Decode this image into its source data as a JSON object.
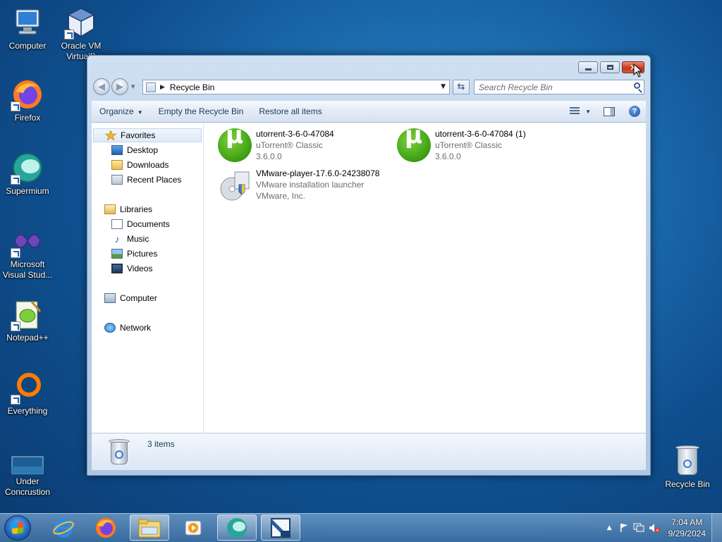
{
  "desktop": {
    "icons": [
      {
        "label": "Computer"
      },
      {
        "label": "Oracle VM VirtualBox",
        "label_line1": "Oracle VM",
        "label_line2": "VirtualB"
      },
      {
        "label": "Firefox"
      },
      {
        "label": "Supermium"
      },
      {
        "label_line1": "Microsoft",
        "label_line2": "Visual Stud..."
      },
      {
        "label": "Notepad++"
      },
      {
        "label": "Everything"
      },
      {
        "label_line1": "Under",
        "label_line2": "Concrustion"
      },
      {
        "label": "Recycle Bin"
      }
    ]
  },
  "window": {
    "address": {
      "crumb": "Recycle Bin"
    },
    "search": {
      "placeholder": "Search Recycle Bin"
    },
    "toolbar": {
      "organize": "Organize",
      "empty": "Empty the Recycle Bin",
      "restore": "Restore all items"
    },
    "nav": {
      "favorites": "Favorites",
      "desktop": "Desktop",
      "downloads": "Downloads",
      "recent": "Recent Places",
      "libraries": "Libraries",
      "documents": "Documents",
      "music": "Music",
      "pictures": "Pictures",
      "videos": "Videos",
      "computer": "Computer",
      "network": "Network"
    },
    "files": [
      {
        "name": "utorrent-3-6-0-47084",
        "desc": "uTorrent® Classic",
        "version": "3.6.0.0",
        "icon": "utorrent-icon"
      },
      {
        "name": "utorrent-3-6-0-47084 (1)",
        "desc": "uTorrent® Classic",
        "version": "3.6.0.0",
        "icon": "utorrent-icon"
      },
      {
        "name": "VMware-player-17.6.0-24238078",
        "desc": "VMware installation launcher",
        "version": "VMware, Inc.",
        "icon": "vmware-installer-icon"
      }
    ],
    "status": {
      "count": "3 items"
    }
  },
  "taskbar": {
    "clock_time": "7:04 AM",
    "clock_date": "9/29/2024"
  },
  "colors": {
    "accent": "#1e395b",
    "close": "#c4341c"
  }
}
